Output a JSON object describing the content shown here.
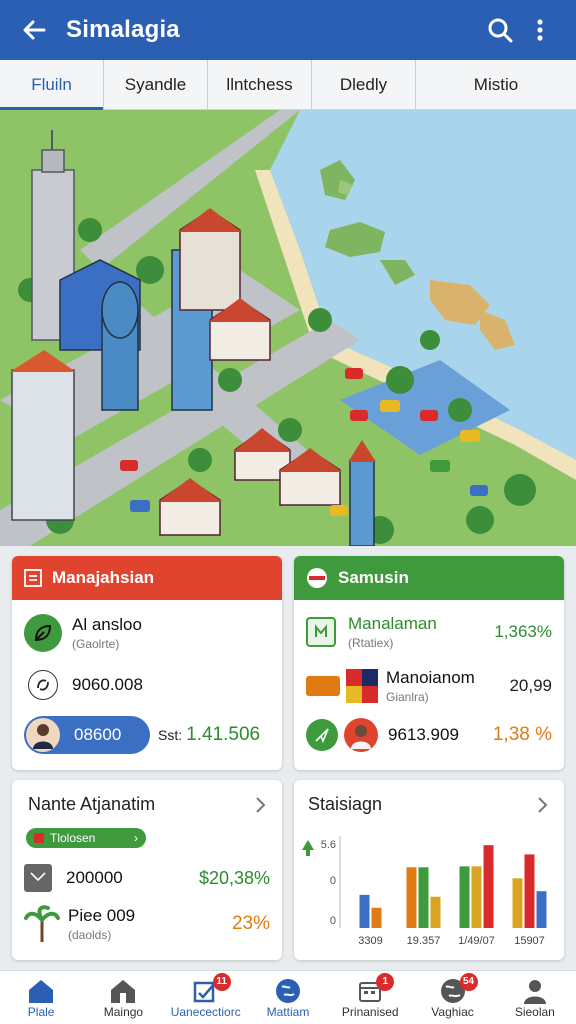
{
  "app": {
    "title": "Simalagia"
  },
  "tabs": [
    {
      "label": "Fluiln",
      "active": true
    },
    {
      "label": "Syandle"
    },
    {
      "label": "llntchess"
    },
    {
      "label": "Dledly"
    },
    {
      "label": "Mistio"
    }
  ],
  "cards": {
    "management": {
      "title": "Manajahsian",
      "accent": "#e0442f",
      "item1": {
        "label": "Al ansloo",
        "sub": "(Gaolrte)"
      },
      "item2": {
        "value": "9060.008"
      },
      "item3": {
        "pill": "08600",
        "prefix": "Sst:",
        "value": "1.41.506"
      }
    },
    "samusin": {
      "title": "Samusin",
      "accent": "#3e9a3c",
      "item1": {
        "label": "Manalaman",
        "sub": "(Rtatiex)",
        "value": "1,363%"
      },
      "item2": {
        "label": "Manoianom",
        "sub": "Gianlra)",
        "value": "20,99"
      },
      "item3": {
        "value": "9613.909",
        "pct": "1,38 %"
      }
    },
    "nante": {
      "title": "Nante Atjanatim",
      "chip": "Tlolosen",
      "item1": {
        "value": "200000",
        "pct": "$20,38%"
      },
      "item2": {
        "label": "Piee 009",
        "sub": "(daolds)",
        "pct": "23%"
      }
    },
    "stats": {
      "title": "Staisiagn"
    }
  },
  "chart_data": {
    "type": "bar",
    "title": "Staisiagn",
    "categories": [
      "3309",
      "19.357",
      "1/49/07",
      "15907"
    ],
    "series_colors": [
      "#3b6fc4",
      "#e07a12",
      "#3e9a3c",
      "#d9a520",
      "#d92b2b"
    ],
    "groups": [
      {
        "category": "3309",
        "values": [
          3.6,
          2.2
        ]
      },
      {
        "category": "19.357",
        "values": [
          6.6,
          6.6,
          3.4
        ]
      },
      {
        "category": "1/49/07",
        "values": [
          6.7,
          6.7,
          9.0
        ]
      },
      {
        "category": "15907",
        "values": [
          5.4,
          8.0,
          4.0
        ]
      }
    ],
    "y_tick_labels": [
      "0",
      "0",
      "5.6"
    ],
    "ylim": [
      0,
      10
    ]
  },
  "bottom_nav": [
    {
      "label": "Plale",
      "icon": "home-icon",
      "active": true
    },
    {
      "label": "Maingo",
      "icon": "house-icon"
    },
    {
      "label": "Uanecectiorc",
      "icon": "task-icon",
      "badge": "11"
    },
    {
      "label": "Mattiam",
      "icon": "globe-icon"
    },
    {
      "label": "Prinanised",
      "icon": "calendar-icon",
      "badge": "1"
    },
    {
      "label": "Vaghiac",
      "icon": "earth-icon",
      "badge": "54"
    },
    {
      "label": "Sieolan",
      "icon": "profile-icon"
    }
  ]
}
